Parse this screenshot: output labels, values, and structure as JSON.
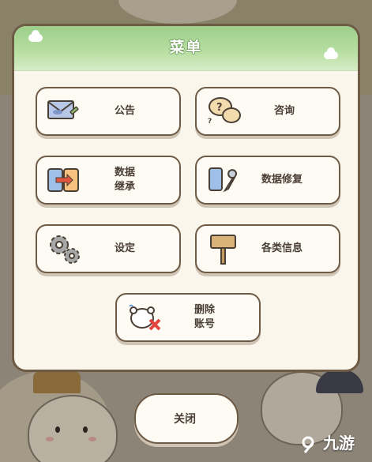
{
  "menu": {
    "title": "菜单",
    "buttons": [
      {
        "key": "announcement",
        "label": "公告",
        "icon": "envelope-icon"
      },
      {
        "key": "inquiry",
        "label": "咨询",
        "icon": "question-bubble-icon"
      },
      {
        "key": "data-transfer",
        "label": "数据\n继承",
        "icon": "device-transfer-icon"
      },
      {
        "key": "data-repair",
        "label": "数据修复",
        "icon": "phone-wrench-icon"
      },
      {
        "key": "settings",
        "label": "设定",
        "icon": "gears-icon"
      },
      {
        "key": "info",
        "label": "各类信息",
        "icon": "signboard-icon"
      },
      {
        "key": "delete-account",
        "label": "删除\n账号",
        "icon": "delete-account-icon"
      }
    ],
    "close_label": "关闭"
  },
  "watermark": {
    "text": "九游"
  }
}
